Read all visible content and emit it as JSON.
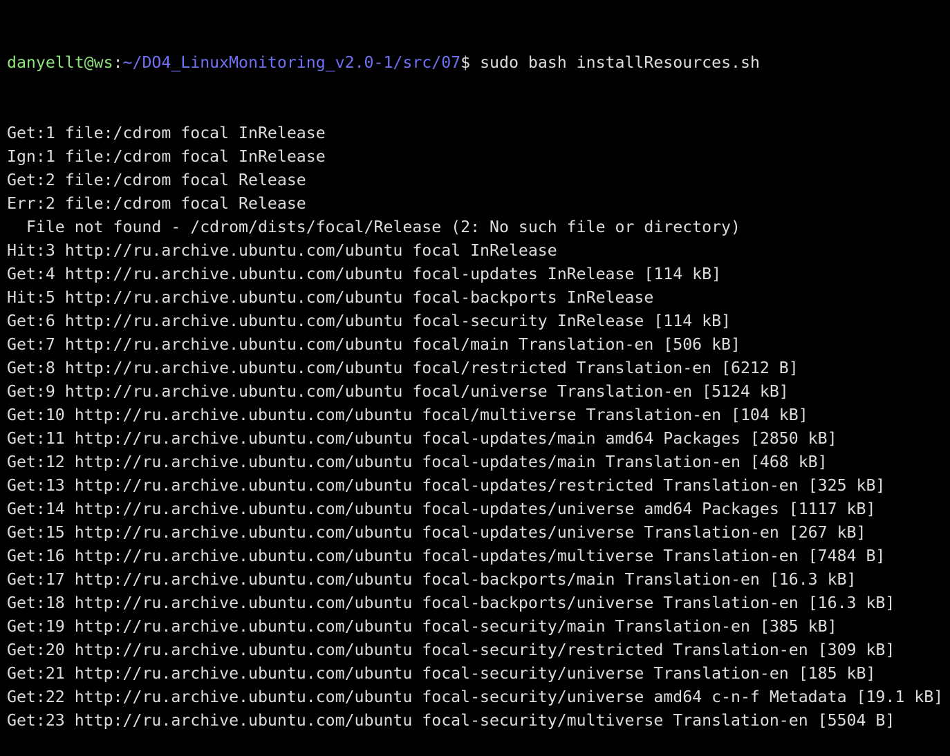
{
  "prompt": {
    "user_host": "danyellt@ws",
    "separator": ":",
    "path": "~/DO4_LinuxMonitoring_v2.0-1/src/07",
    "symbol": "$ ",
    "command": "sudo bash installResources.sh"
  },
  "colors": {
    "background": "#000000",
    "text": "#dcdcdc",
    "user_host": "#8fe27c",
    "path": "#6f70f2"
  },
  "output_lines": [
    "Get:1 file:/cdrom focal InRelease",
    "Ign:1 file:/cdrom focal InRelease",
    "Get:2 file:/cdrom focal Release",
    "Err:2 file:/cdrom focal Release",
    "  File not found - /cdrom/dists/focal/Release (2: No such file or directory)",
    "Hit:3 http://ru.archive.ubuntu.com/ubuntu focal InRelease",
    "Get:4 http://ru.archive.ubuntu.com/ubuntu focal-updates InRelease [114 kB]",
    "Hit:5 http://ru.archive.ubuntu.com/ubuntu focal-backports InRelease",
    "Get:6 http://ru.archive.ubuntu.com/ubuntu focal-security InRelease [114 kB]",
    "Get:7 http://ru.archive.ubuntu.com/ubuntu focal/main Translation-en [506 kB]",
    "Get:8 http://ru.archive.ubuntu.com/ubuntu focal/restricted Translation-en [6212 B]",
    "Get:9 http://ru.archive.ubuntu.com/ubuntu focal/universe Translation-en [5124 kB]",
    "Get:10 http://ru.archive.ubuntu.com/ubuntu focal/multiverse Translation-en [104 kB]",
    "Get:11 http://ru.archive.ubuntu.com/ubuntu focal-updates/main amd64 Packages [2850 kB]",
    "Get:12 http://ru.archive.ubuntu.com/ubuntu focal-updates/main Translation-en [468 kB]",
    "Get:13 http://ru.archive.ubuntu.com/ubuntu focal-updates/restricted Translation-en [325 kB]",
    "Get:14 http://ru.archive.ubuntu.com/ubuntu focal-updates/universe amd64 Packages [1117 kB]",
    "Get:15 http://ru.archive.ubuntu.com/ubuntu focal-updates/universe Translation-en [267 kB]",
    "Get:16 http://ru.archive.ubuntu.com/ubuntu focal-updates/multiverse Translation-en [7484 B]",
    "Get:17 http://ru.archive.ubuntu.com/ubuntu focal-backports/main Translation-en [16.3 kB]",
    "Get:18 http://ru.archive.ubuntu.com/ubuntu focal-backports/universe Translation-en [16.3 kB]",
    "Get:19 http://ru.archive.ubuntu.com/ubuntu focal-security/main Translation-en [385 kB]",
    "Get:20 http://ru.archive.ubuntu.com/ubuntu focal-security/restricted Translation-en [309 kB]",
    "Get:21 http://ru.archive.ubuntu.com/ubuntu focal-security/universe Translation-en [185 kB]",
    "Get:22 http://ru.archive.ubuntu.com/ubuntu focal-security/universe amd64 c-n-f Metadata [19.1 kB]",
    "Get:23 http://ru.archive.ubuntu.com/ubuntu focal-security/multiverse Translation-en [5504 B]"
  ]
}
